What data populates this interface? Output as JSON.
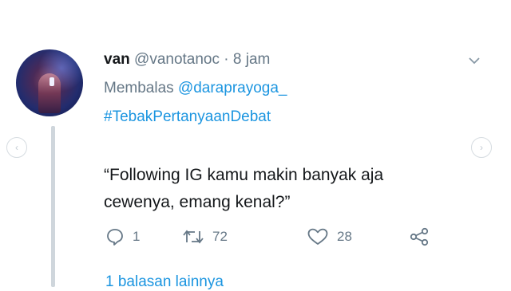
{
  "tweet": {
    "display_name": "van",
    "handle": "@vanotanoc",
    "separator": "·",
    "time": "8 jam",
    "reply_prefix": "Membalas",
    "reply_to": "@daraprayoga_",
    "hashtag": "#TebakPertanyaanDebat",
    "text": "“Following IG kamu makin banyak aja cewenya, emang kenal?”"
  },
  "actions": {
    "replies": "1",
    "retweets": "72",
    "likes": "28"
  },
  "thread": {
    "more_replies_link": "1 balasan lainnya"
  },
  "icons": {
    "reply": "speech-bubble-icon",
    "retweet": "retweet-arrows-icon",
    "like": "heart-icon",
    "share": "share-nodes-icon",
    "menu": "chevron-down-icon",
    "nav_prev": "chevron-left-icon",
    "nav_next": "chevron-right-icon"
  },
  "colors": {
    "link_blue": "#1b95e0",
    "text_dark": "#14171a",
    "text_gray": "#657786"
  }
}
